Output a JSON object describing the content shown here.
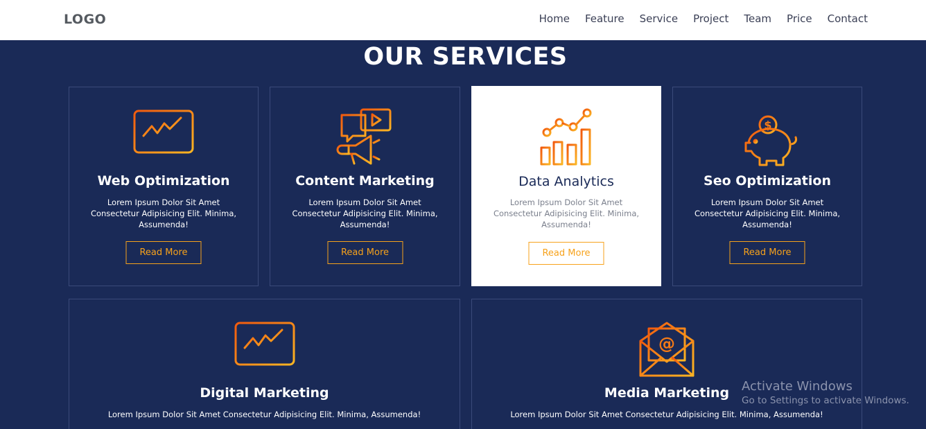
{
  "navbar": {
    "logo": "LOGO",
    "links": [
      "Home",
      "Feature",
      "Service",
      "Project",
      "Team",
      "Price",
      "Contact"
    ]
  },
  "section": {
    "title": "OUR SERVICES"
  },
  "cards": [
    {
      "title": "Web Optimization",
      "text_line1": "Lorem Ipsum Dolor Sit Amet",
      "text_line2": "Consectetur Adipisicing Elit. Minima,",
      "text_line3": "Assumenda!",
      "button": "Read More",
      "icon": "monitor-chart-icon"
    },
    {
      "title": "Content Marketing",
      "text_line1": "Lorem Ipsum Dolor Sit Amet",
      "text_line2": "Consectetur Adipisicing Elit. Minima,",
      "text_line3": "Assumenda!",
      "button": "Read More",
      "icon": "megaphone-icon"
    },
    {
      "title": "Data Analytics",
      "text_line1": "Lorem Ipsum Dolor Sit Amet",
      "text_line2": "Consectetur Adipisicing Elit. Minima,",
      "text_line3": "Assumenda!",
      "button": "Read More",
      "icon": "bar-chart-icon"
    },
    {
      "title": "Seo Optimization",
      "text_line1": "Lorem Ipsum Dolor Sit Amet",
      "text_line2": "Consectetur Adipisicing Elit. Minima,",
      "text_line3": "Assumenda!",
      "button": "Read More",
      "icon": "piggy-bank-icon"
    },
    {
      "title": "Digital Marketing",
      "text": "Lorem Ipsum Dolor Sit Amet Consectetur Adipisicing Elit. Minima, Assumenda!",
      "icon": "monitor-chart-icon"
    },
    {
      "title": "Media Marketing",
      "text": "Lorem Ipsum Dolor Sit Amet Consectetur Adipisicing Elit. Minima, Assumenda!",
      "icon": "email-envelope-icon"
    }
  ],
  "watermark": {
    "line1": "Activate Windows",
    "line2": "Go to Settings to activate Windows."
  },
  "colors": {
    "background": "#1a2a57",
    "accent": "#f7a21b",
    "accent_dark": "#f25a0e",
    "navbar": "#ffffff"
  }
}
